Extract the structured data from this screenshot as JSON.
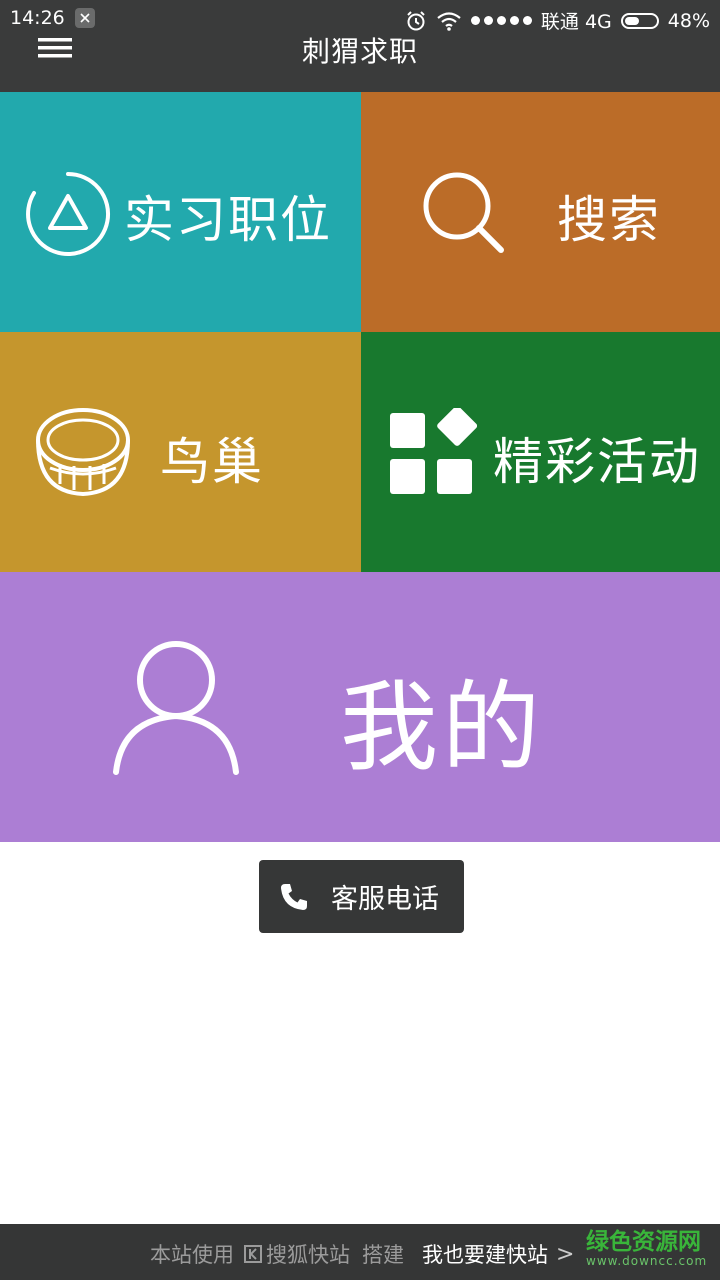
{
  "status_bar": {
    "time": "14:26",
    "carrier": "联通 4G",
    "battery": "48%",
    "battery_level": 0.48,
    "icons": [
      "notification-app-icon",
      "alarm-icon",
      "wifi-icon",
      "signal-dots-icon",
      "battery-icon"
    ]
  },
  "app_bar": {
    "title": "刺猬求职",
    "menu_icon": "hamburger-menu-icon"
  },
  "tiles": {
    "intern": {
      "label": "实习职位",
      "icon": "triangle-circle-icon",
      "color": "#22a9ad"
    },
    "search": {
      "label": "搜索",
      "icon": "magnifier-icon",
      "color": "#bb6c28"
    },
    "nest": {
      "label": "鸟巢",
      "icon": "nest-icon",
      "color": "#c5962d"
    },
    "events": {
      "label": "精彩活动",
      "icon": "apps-grid-icon",
      "color": "#18792e"
    },
    "mine": {
      "label": "我的",
      "icon": "user-icon",
      "color": "#ac7ed4"
    }
  },
  "service_button": {
    "label": "客服电话",
    "icon": "phone-icon"
  },
  "footer": {
    "prefix": "本站使用",
    "brand": "搜狐快站",
    "suffix": "搭建",
    "cta": "我也要建快站",
    "chevron": ">",
    "watermark": "绿色资源网",
    "watermark_url": "www.downcc.com"
  }
}
